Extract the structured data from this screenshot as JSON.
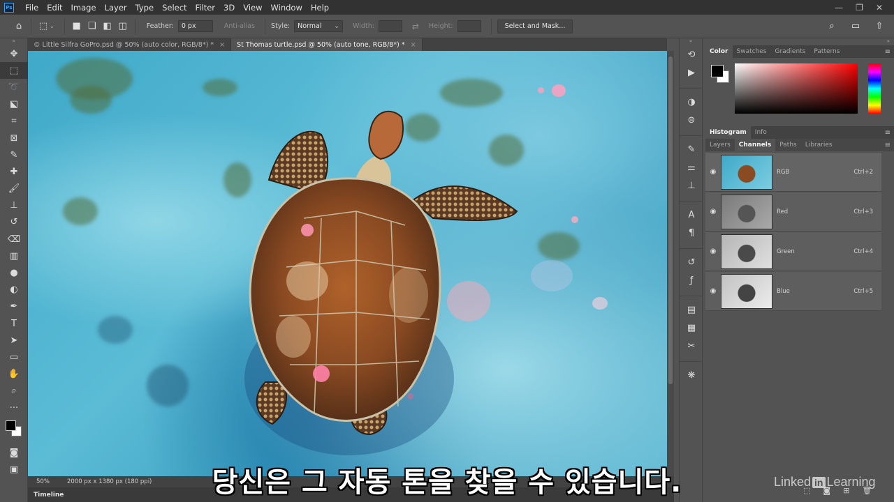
{
  "menubar": {
    "logo": "Ps",
    "items": [
      "File",
      "Edit",
      "Image",
      "Layer",
      "Type",
      "Select",
      "Filter",
      "3D",
      "View",
      "Window",
      "Help"
    ],
    "window_controls": [
      "—",
      "❐",
      "✕"
    ]
  },
  "options": {
    "feather_label": "Feather:",
    "feather_value": "0 px",
    "antialias_label": "Anti-alias",
    "style_label": "Style:",
    "style_value": "Normal",
    "width_label": "Width:",
    "height_label": "Height:",
    "select_mask_label": "Select and Mask..."
  },
  "tabs": [
    {
      "label": "© Little Silfra GoPro.psd @ 50% (auto color, RGB/8*) *",
      "active": false
    },
    {
      "label": "St Thomas turtle.psd @ 50% (auto tone, RGB/8*) *",
      "active": true
    }
  ],
  "status": {
    "zoom": "50%",
    "doc_size": "2000 px x 1380 px (180 ppi)"
  },
  "timeline_label": "Timeline",
  "color_panel": {
    "tabs": [
      "Color",
      "Swatches",
      "Gradients",
      "Patterns"
    ],
    "active": "Color"
  },
  "histogram_panel": {
    "tabs": [
      "Histogram",
      "Info"
    ],
    "active": "Histogram"
  },
  "channels_panel": {
    "tabs": [
      "Layers",
      "Channels",
      "Paths",
      "Libraries"
    ],
    "active": "Channels",
    "channels": [
      {
        "name": "RGB",
        "shortcut": "Ctrl+2"
      },
      {
        "name": "Red",
        "shortcut": "Ctrl+3"
      },
      {
        "name": "Green",
        "shortcut": "Ctrl+4"
      },
      {
        "name": "Blue",
        "shortcut": "Ctrl+5"
      }
    ]
  },
  "subtitle": "당신은 그 자동 톤을 찾을 수 있습니다.",
  "watermark": {
    "pre": "Linked",
    "box": "in",
    "post": " Learning"
  },
  "colors": {
    "ui_dark": "#323232",
    "ui_mid": "#535353",
    "accent": "#31a8ff",
    "water": "#4fb4d2"
  }
}
